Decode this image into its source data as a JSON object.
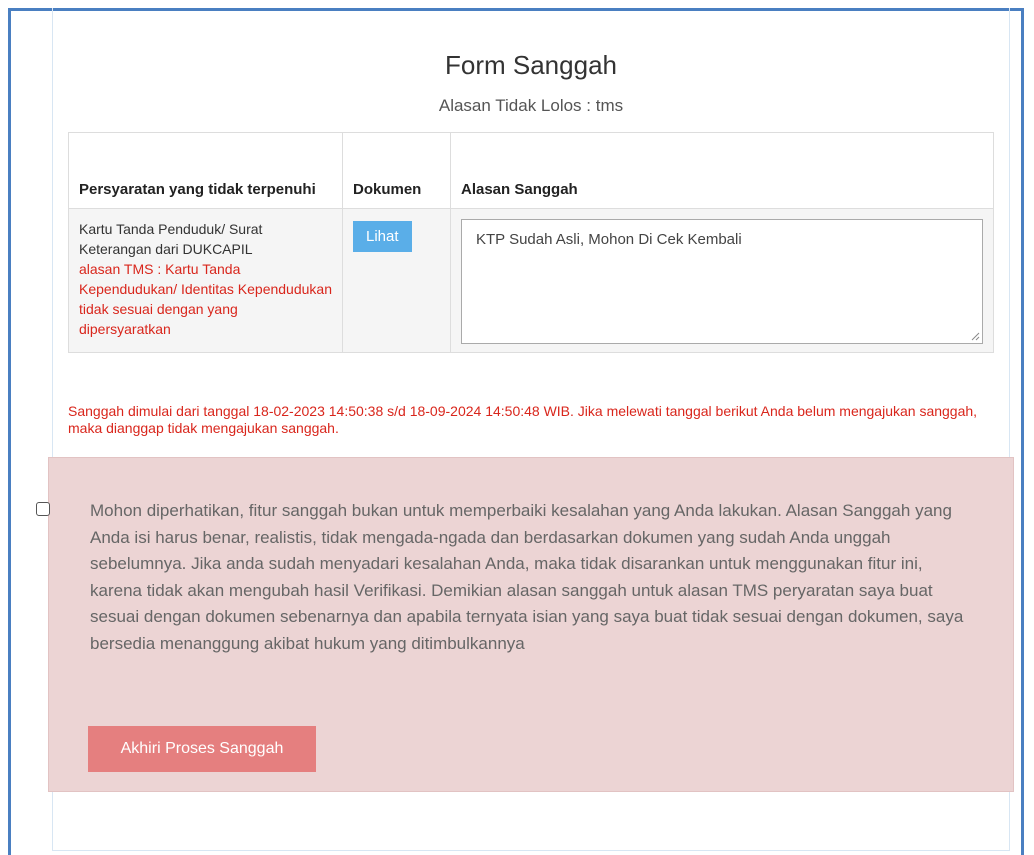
{
  "form": {
    "title": "Form Sanggah",
    "subtitle": "Alasan Tidak Lolos : tms"
  },
  "table": {
    "headers": [
      "Persyaratan yang tidak terpenuhi",
      "Dokumen",
      "Alasan Sanggah"
    ],
    "rows": [
      {
        "requirement": "Kartu Tanda Penduduk/ Surat Keterangan dari DUKCAPIL",
        "reason_tms": "alasan TMS : Kartu Tanda Kependudukan/ Identitas Kependudukan tidak sesuai dengan yang dipersyaratkan",
        "document_button": "Lihat",
        "appeal_text": "KTP Sudah Asli, Mohon Di Cek Kembali"
      }
    ]
  },
  "notice": "Sanggah dimulai dari tanggal 18-02-2023 14:50:38 s/d 18-09-2024 14:50:48 WIB. Jika melewati tanggal berikut Anda belum mengajukan sanggah, maka dianggap tidak mengajukan sanggah.",
  "agreement": {
    "checked": false,
    "text": "Mohon diperhatikan, fitur sanggah bukan untuk memperbaiki kesalahan yang Anda lakukan. Alasan Sanggah yang Anda isi harus benar, realistis, tidak mengada-ngada dan berdasarkan dokumen yang sudah Anda unggah sebelumnya. Jika anda sudah menyadari kesalahan Anda, maka tidak disarankan untuk menggunakan fitur ini, karena tidak akan mengubah hasil Verifikasi. Demikian alasan sanggah untuk alasan TMS peryaratan saya buat sesuai dengan dokumen sebenarnya dan apabila ternyata isian yang saya buat tidak sesuai dengan dokumen, saya bersedia menanggung akibat hukum yang ditimbulkannya"
  },
  "actions": {
    "finish_label": "Akhiri Proses Sanggah"
  },
  "colors": {
    "frame": "#4a7fc1",
    "alert_bg": "#ecd4d4",
    "danger_text": "#d9261c",
    "info_button": "#5aaee8",
    "finish_button": "#e57f7f"
  }
}
